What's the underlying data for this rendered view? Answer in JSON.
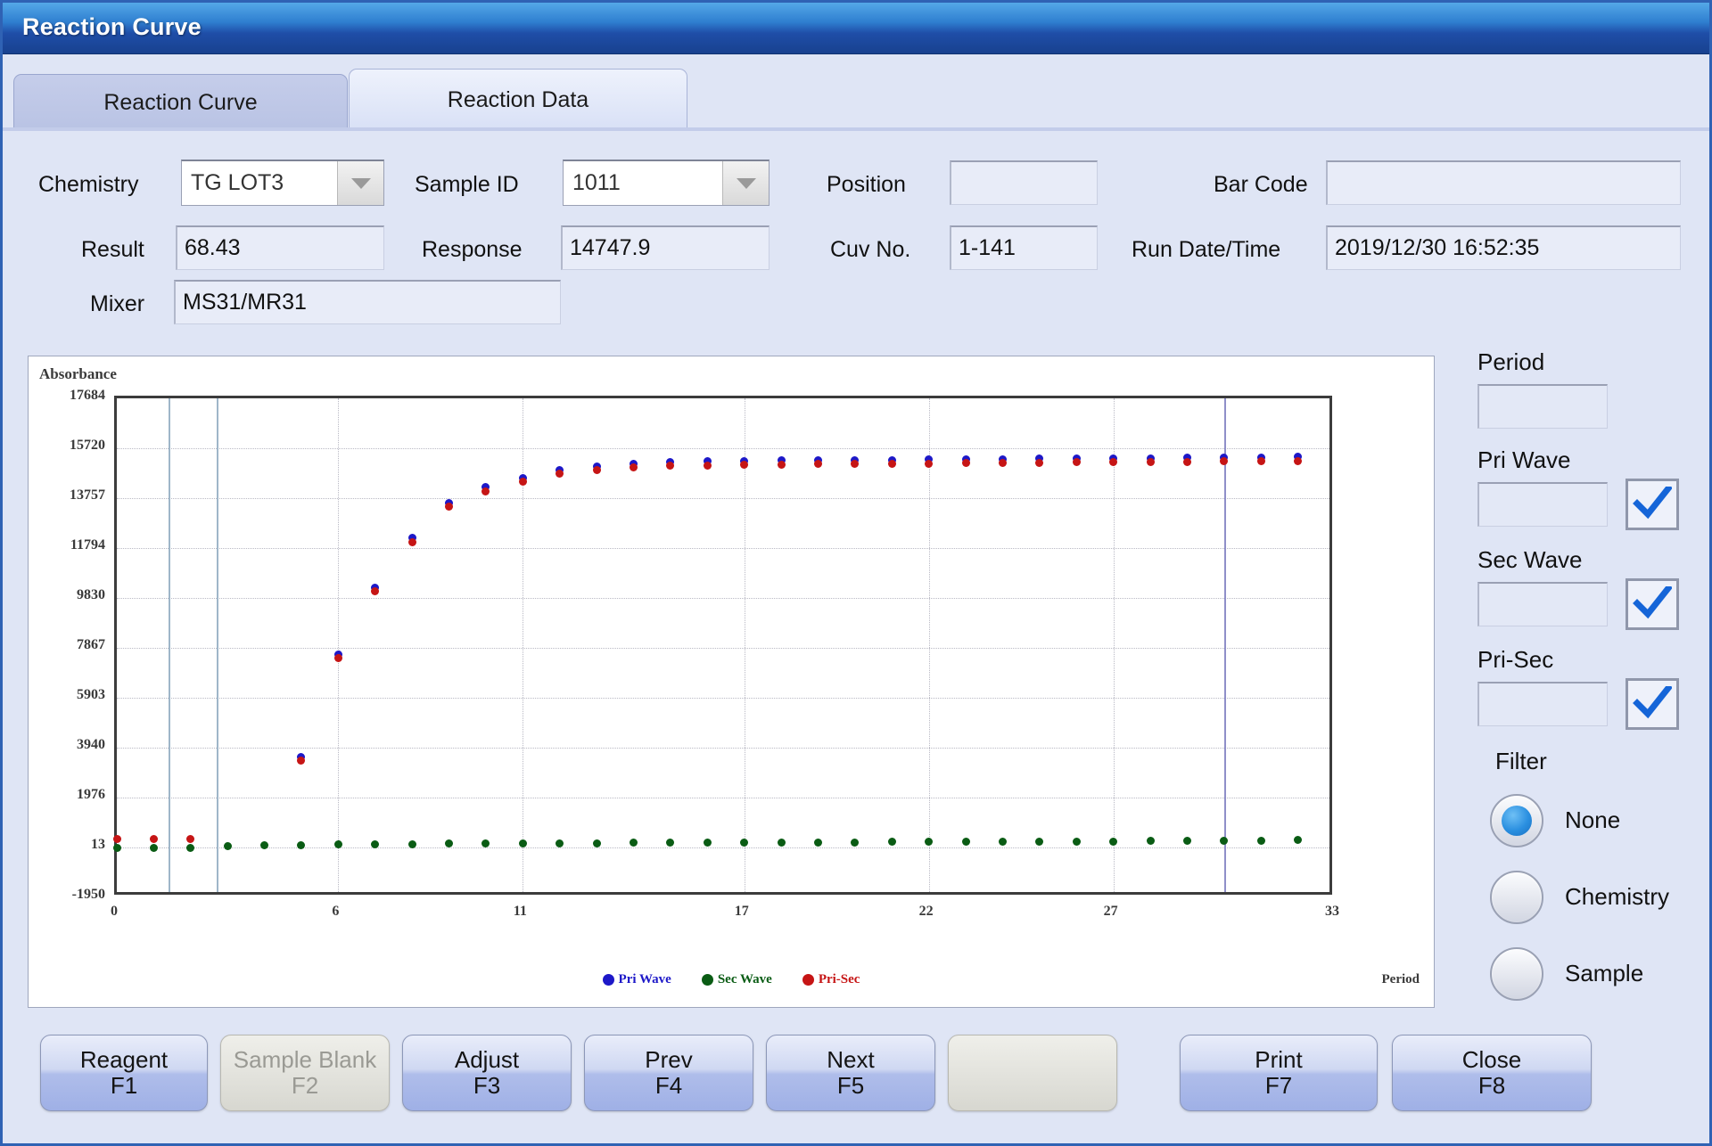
{
  "window": {
    "title": "Reaction Curve"
  },
  "tabs": [
    {
      "label": "Reaction Curve",
      "active": false
    },
    {
      "label": "Reaction Data",
      "active": true
    }
  ],
  "form": {
    "chemistry": {
      "label": "Chemistry",
      "value": "TG LOT3"
    },
    "sample_id": {
      "label": "Sample ID",
      "value": "1011"
    },
    "position": {
      "label": "Position",
      "value": ""
    },
    "bar_code": {
      "label": "Bar Code",
      "value": ""
    },
    "result": {
      "label": "Result",
      "value": "68.43"
    },
    "response": {
      "label": "Response",
      "value": "14747.9"
    },
    "cuv_no": {
      "label": "Cuv No.",
      "value": "1-141"
    },
    "run_datetime": {
      "label": "Run Date/Time",
      "value": "2019/12/30 16:52:35"
    },
    "mixer": {
      "label": "Mixer",
      "value": "MS31/MR31"
    }
  },
  "right_panel": {
    "period": {
      "label": "Period",
      "value": ""
    },
    "pri_wave": {
      "label": "Pri Wave",
      "value": "",
      "checked": true
    },
    "sec_wave": {
      "label": "Sec Wave",
      "value": "",
      "checked": true
    },
    "pri_sec": {
      "label": "Pri-Sec",
      "value": "",
      "checked": true
    },
    "filter": {
      "label": "Filter",
      "options": [
        {
          "label": "None",
          "selected": true
        },
        {
          "label": "Chemistry",
          "selected": false
        },
        {
          "label": "Sample",
          "selected": false
        }
      ]
    }
  },
  "buttons": [
    {
      "label": "Reagent",
      "key": "F1",
      "disabled": false
    },
    {
      "label": "Sample Blank",
      "key": "F2",
      "disabled": true
    },
    {
      "label": "Adjust",
      "key": "F3",
      "disabled": false
    },
    {
      "label": "Prev",
      "key": "F4",
      "disabled": false
    },
    {
      "label": "Next",
      "key": "F5",
      "disabled": false
    },
    {
      "label": "",
      "key": "",
      "disabled": true
    },
    {
      "label": "Print",
      "key": "F7",
      "disabled": false
    },
    {
      "label": "Close",
      "key": "F8",
      "disabled": false
    }
  ],
  "colors": {
    "pri_wave": "#1d18c8",
    "sec_wave": "#0a5c14",
    "pri_sec": "#c61515",
    "titlebar": "#1f4ea8",
    "panel": "#dfe5f5"
  },
  "chart_data": {
    "type": "scatter",
    "title": "",
    "ylabel": "Absorbance",
    "xlabel": "Period",
    "ylim": [
      -1950,
      17684
    ],
    "xlim": [
      0,
      33
    ],
    "grid": true,
    "legend_position": "bottom-center",
    "yticks": [
      17684,
      15720,
      13757,
      11794,
      9830,
      7867,
      5903,
      3940,
      1976,
      13,
      -1950
    ],
    "xticks": [
      0,
      6,
      11,
      17,
      22,
      27,
      33
    ],
    "markers": [
      1.4,
      2.7,
      30.0
    ],
    "series": [
      {
        "name": "Pri Wave",
        "color": "#1d18c8",
        "x": [
          5,
          6,
          7,
          8,
          9,
          10,
          11,
          12,
          13,
          14,
          15,
          16,
          17,
          18,
          19,
          20,
          21,
          22,
          23,
          24,
          25,
          26,
          27,
          28,
          29,
          30,
          31,
          32
        ],
        "y": [
          3580,
          7620,
          10230,
          12180,
          13560,
          14180,
          14560,
          14860,
          15000,
          15120,
          15180,
          15200,
          15220,
          15230,
          15240,
          15250,
          15260,
          15270,
          15280,
          15290,
          15300,
          15310,
          15320,
          15330,
          15340,
          15350,
          15360,
          15370
        ]
      },
      {
        "name": "Sec Wave",
        "color": "#0a5c14",
        "x": [
          0,
          1,
          2,
          3,
          4,
          5,
          6,
          7,
          8,
          9,
          10,
          11,
          12,
          13,
          14,
          15,
          16,
          17,
          18,
          19,
          20,
          21,
          22,
          23,
          24,
          25,
          26,
          27,
          28,
          29,
          30,
          31,
          32
        ],
        "y": [
          13,
          13,
          13,
          60,
          90,
          110,
          130,
          140,
          150,
          160,
          170,
          175,
          180,
          185,
          190,
          195,
          200,
          205,
          210,
          215,
          220,
          225,
          230,
          235,
          240,
          245,
          250,
          255,
          260,
          270,
          280,
          290,
          300
        ]
      },
      {
        "name": "Pri-Sec",
        "color": "#c61515",
        "x": [
          0,
          1,
          2,
          5,
          6,
          7,
          8,
          9,
          10,
          11,
          12,
          13,
          14,
          15,
          16,
          17,
          18,
          19,
          20,
          21,
          22,
          23,
          24,
          25,
          26,
          27,
          28,
          29,
          30,
          31,
          32
        ],
        "y": [
          330,
          330,
          330,
          3430,
          7470,
          10080,
          12030,
          13410,
          14030,
          14410,
          14710,
          14850,
          14970,
          15030,
          15050,
          15070,
          15080,
          15090,
          15100,
          15110,
          15120,
          15130,
          15140,
          15150,
          15160,
          15170,
          15180,
          15190,
          15200,
          15210,
          15220
        ]
      }
    ],
    "legend": [
      "Pri Wave",
      "Sec Wave",
      "Pri-Sec"
    ]
  }
}
